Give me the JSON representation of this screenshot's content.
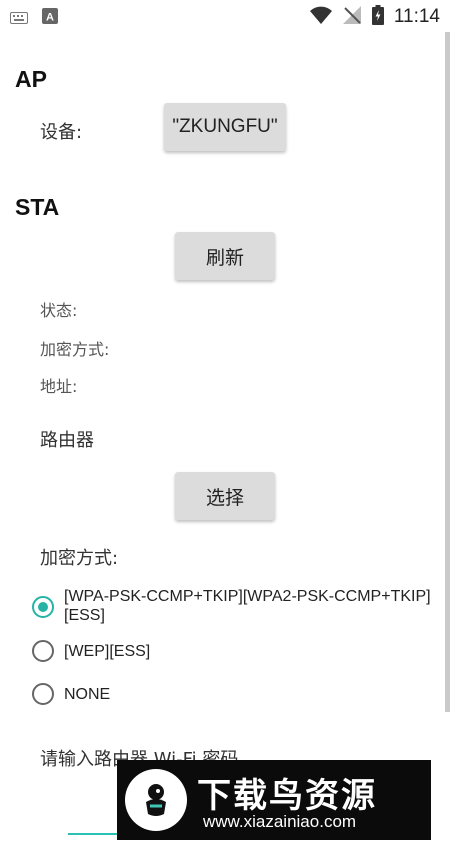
{
  "status_bar": {
    "time": "11:14",
    "left_icons": [
      "keyboard-icon",
      "a-square-icon"
    ],
    "right_icons": [
      "wifi-icon",
      "no-signal-icon",
      "battery-icon"
    ]
  },
  "ap": {
    "title": "AP",
    "device_label": "设备:",
    "device_button": "\"ZKUNGFU\""
  },
  "sta": {
    "title": "STA",
    "refresh_button": "刷新",
    "status_label": "状态:",
    "encryption_label": "加密方式:",
    "address_label": "地址:",
    "router_label": "路由器",
    "select_button": "选择"
  },
  "encryption": {
    "label": "加密方式:",
    "options": [
      {
        "text": "[WPA-PSK-CCMP+TKIP][WPA2-PSK-CCMP+TKIP][ESS]",
        "checked": true
      },
      {
        "text": "[WEP][ESS]",
        "checked": false
      },
      {
        "text": "NONE",
        "checked": false
      }
    ]
  },
  "password": {
    "label": "请输入路由器 Wi-Fi 密码",
    "value": ""
  },
  "watermark": {
    "title": "下载鸟资源",
    "url": "www.xiazainiao.com"
  },
  "colors": {
    "accent": "#26b3a6",
    "button_bg": "#dcdcdc",
    "watermark_bg": "#0b0b0b"
  }
}
